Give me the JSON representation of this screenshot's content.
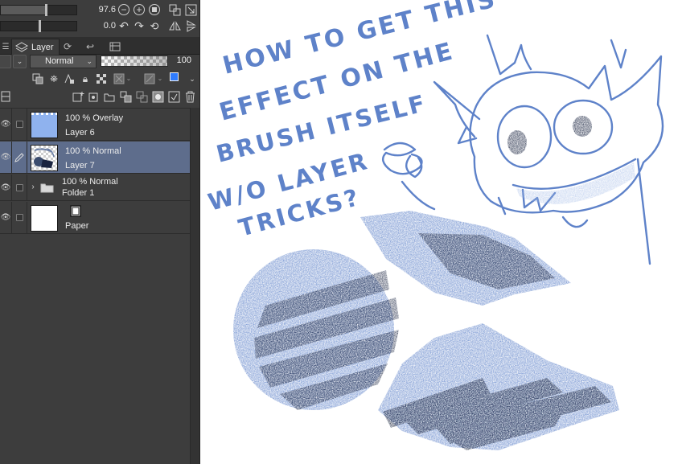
{
  "navigator": {
    "zoom_value": "97.6",
    "rotate_value": "0.0",
    "zoom_slider_fraction": 0.58,
    "rotate_slider_fraction": 0.5
  },
  "tabs": [
    {
      "label": "",
      "icon": "layer-property-icon"
    },
    {
      "label": "Layer",
      "icon": "layer-stack-icon"
    },
    {
      "label": "",
      "icon": "search-layer-icon"
    },
    {
      "label": "",
      "icon": "history-icon"
    },
    {
      "label": "",
      "icon": "animation-cels-icon"
    }
  ],
  "layer_panel": {
    "blend_mode": "Normal",
    "opacity_value": "100",
    "layers": [
      {
        "name": "Layer 6",
        "blend": "100 % Overlay",
        "selected": false,
        "has_pen_icon": false,
        "thumbnail": "solid",
        "thumbnail_color": "#8fb2ee"
      },
      {
        "name": "Layer 7",
        "blend": "100 % Normal",
        "selected": true,
        "has_pen_icon": true,
        "thumbnail": "sketch",
        "thumbnail_color": "#dcdcdc"
      },
      {
        "name": "Folder 1",
        "blend": "100 % Normal",
        "selected": false,
        "has_pen_icon": false,
        "thumbnail": "folder",
        "thumbnail_color": ""
      },
      {
        "name": "Paper",
        "blend": "",
        "selected": false,
        "has_pen_icon": false,
        "thumbnail": "paper",
        "thumbnail_color": "#ffffff"
      }
    ]
  },
  "canvas": {
    "handwritten_lines": [
      "HOW TO GET THIS",
      "EFFECT ON THE",
      "BRUSH ITSELF",
      "W/O LAYER",
      "TRICKS?"
    ],
    "ink_color": "#5e82c9",
    "dark_ink_color": "#101a34"
  },
  "colors": {
    "panel_bg": "#3d3d3d",
    "selected_row": "#5e6d8c",
    "main_color_swatch": "#2f7cff"
  }
}
